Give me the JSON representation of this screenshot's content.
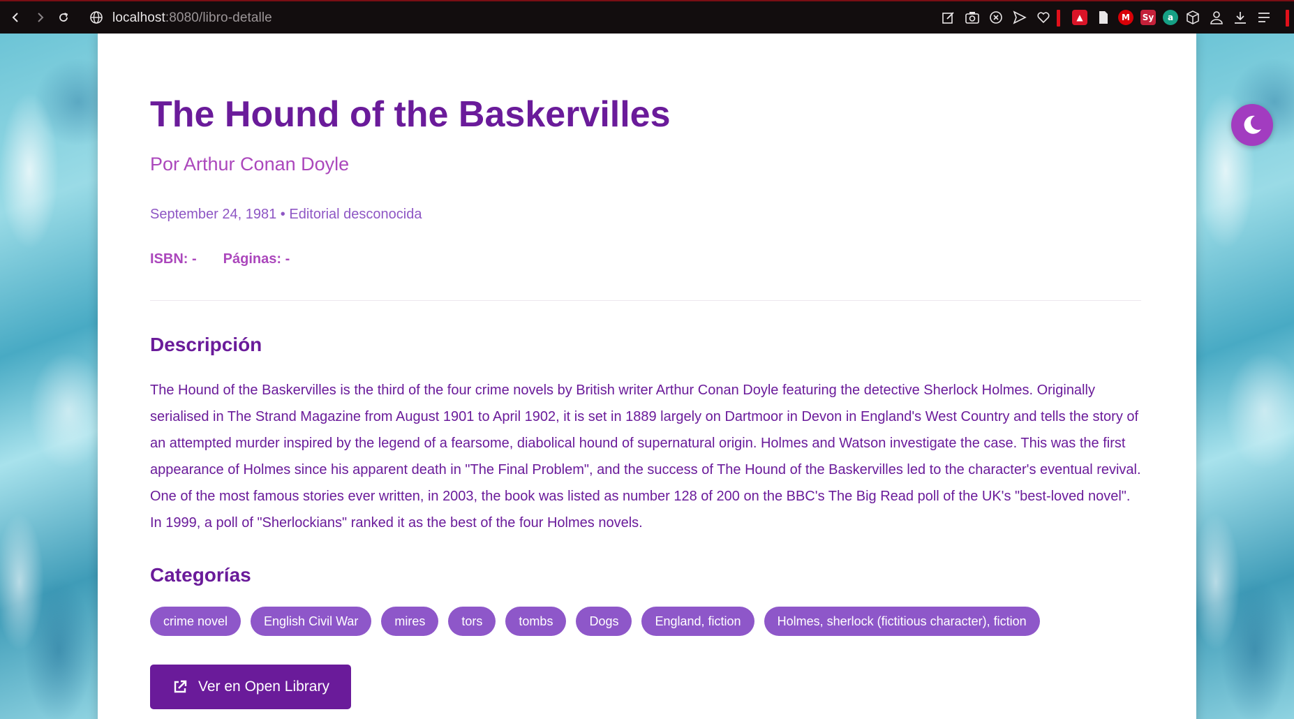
{
  "browser": {
    "url_host": "localhost",
    "url_rest": ":8080/libro-detalle",
    "nav": {
      "back": "chevron-left-icon",
      "forward": "chevron-right-icon",
      "reload": "reload-icon"
    },
    "extensions": [
      {
        "name": "mega-extension",
        "label": "M",
        "color": "#d90007"
      },
      {
        "name": "sy-extension",
        "label": "Sy",
        "color": "#c4213a"
      },
      {
        "name": "a-extension",
        "label": "a",
        "color": "#16a085"
      }
    ]
  },
  "book": {
    "title": "The Hound of the Baskervilles",
    "author_line": "Por Arthur Conan Doyle",
    "meta_line": "September 24, 1981 • Editorial desconocida",
    "isbn": "ISBN: -",
    "pages": "Páginas: -",
    "description_heading": "Descripción",
    "description": "The Hound of the Baskervilles is the third of the four crime novels by British writer Arthur Conan Doyle featuring the detective Sherlock Holmes. Originally serialised in The Strand Magazine from August 1901 to April 1902, it is set in 1889 largely on Dartmoor in Devon in England's West Country and tells the story of an attempted murder inspired by the legend of a fearsome, diabolical hound of supernatural origin. Holmes and Watson investigate the case. This was the first appearance of Holmes since his apparent death in \"The Final Problem\", and the success of The Hound of the Baskervilles led to the character's eventual revival. One of the most famous stories ever written, in 2003, the book was listed as number 128 of 200 on the BBC's The Big Read poll of the UK's \"best-loved novel\". In 1999, a poll of \"Sherlockians\" ranked it as the best of the four Holmes novels.",
    "categories_heading": "Categorías",
    "categories": [
      "crime novel",
      "English Civil War",
      "mires",
      "tors",
      "tombs",
      "Dogs",
      "England, fiction",
      "Holmes, sherlock (fictitious character), fiction"
    ],
    "open_library_label": "Ver en Open Library"
  },
  "theme_toggle": {
    "icon": "moon-icon"
  },
  "colors": {
    "primary": "#6a1b9a",
    "accent": "#ab47bc",
    "tag": "#8e57c9",
    "toggle": "#a23cc0"
  }
}
